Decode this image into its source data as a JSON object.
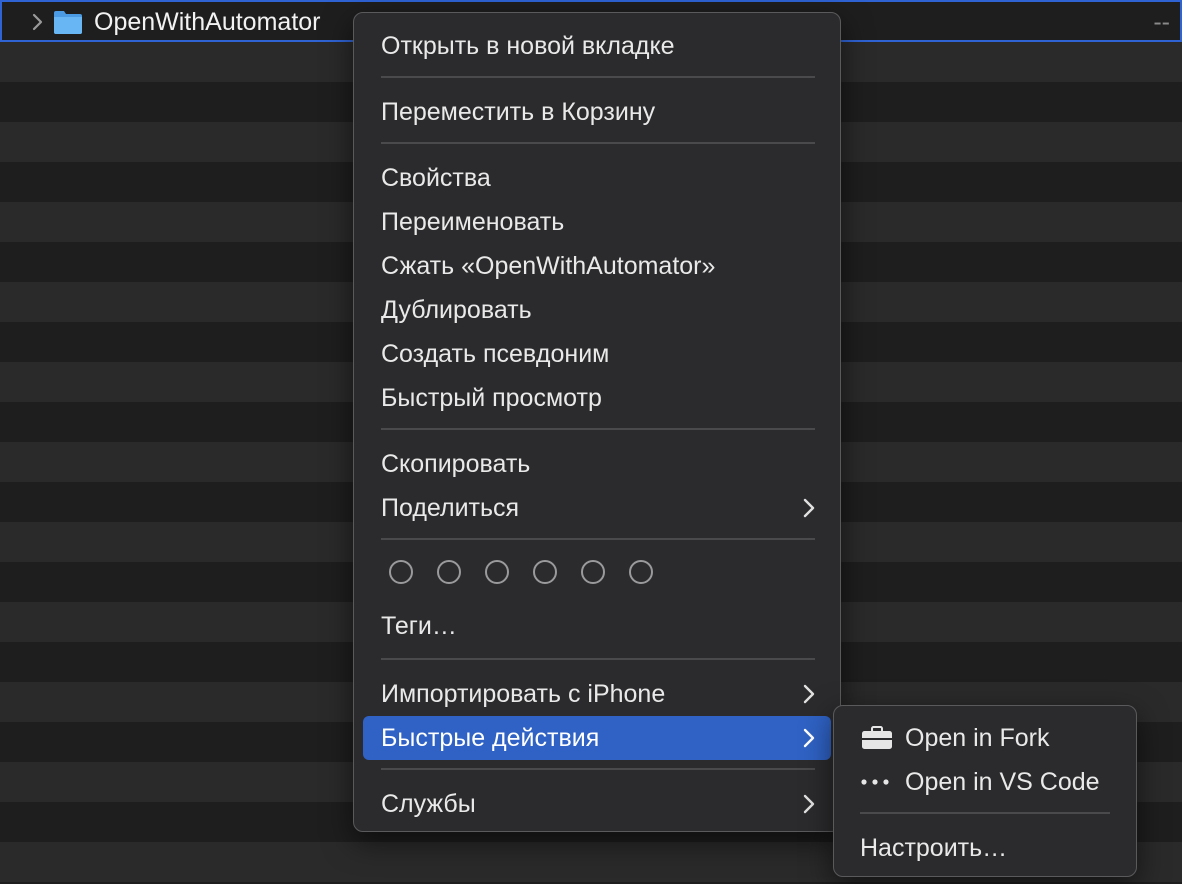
{
  "file": {
    "name": "OpenWithAutomator",
    "meta": "--"
  },
  "menu": {
    "open_new_tab": "Открыть в новой вкладке",
    "move_to_trash": "Переместить в Корзину",
    "properties": "Свойства",
    "rename": "Переименовать",
    "compress": "Сжать «OpenWithAutomator»",
    "duplicate": "Дублировать",
    "make_alias": "Создать псевдоним",
    "quick_look": "Быстрый просмотр",
    "copy": "Скопировать",
    "share": "Поделиться",
    "tags": "Теги…",
    "import_iphone": "Импортировать с iPhone",
    "quick_actions": "Быстрые действия",
    "services": "Службы"
  },
  "submenu": {
    "open_fork": "Open in Fork",
    "open_vscode": "Open in VS Code",
    "customize": "Настроить…"
  },
  "colors": {
    "highlight": "#2f62c4",
    "selection_border": "#2f63d4",
    "folder": "#5aaef0"
  }
}
